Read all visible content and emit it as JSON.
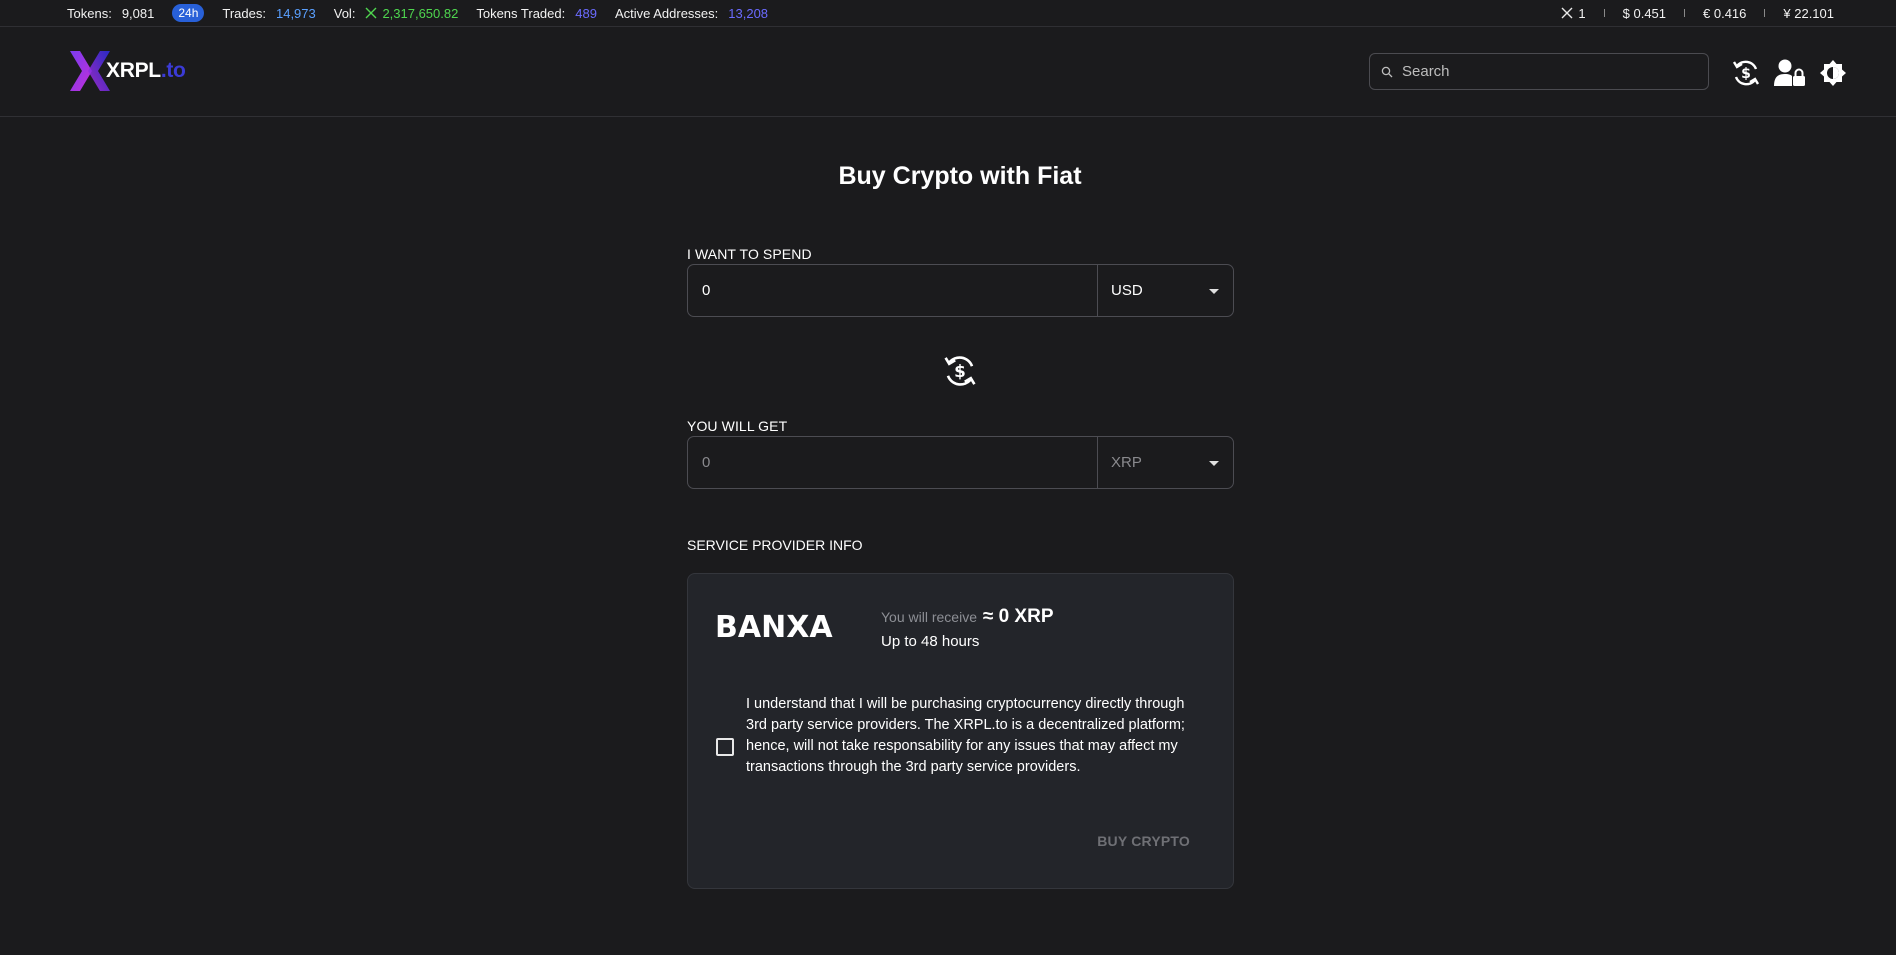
{
  "stats": {
    "tokens_label": "Tokens:",
    "tokens_value": "9,081",
    "period_badge": "24h",
    "trades_label": "Trades:",
    "trades_value": "14,973",
    "vol_label": "Vol:",
    "vol_value": "2,317,650.82",
    "tokens_traded_label": "Tokens Traded:",
    "tokens_traded_value": "489",
    "active_label": "Active Addresses:",
    "active_value": "13,208"
  },
  "prices": {
    "xrp": "1",
    "usd": "$ 0.451",
    "eur": "€ 0.416",
    "cny": "¥ 22.101"
  },
  "header": {
    "logo_main": "XRPL",
    "logo_suffix": ".to",
    "search_placeholder": "Search"
  },
  "page": {
    "title": "Buy Crypto with Fiat"
  },
  "spend": {
    "label": "I WANT TO SPEND",
    "amount": "0",
    "currency": "USD"
  },
  "get": {
    "label": "YOU WILL GET",
    "amount": "0",
    "currency": "XRP"
  },
  "provider": {
    "section_label": "SERVICE PROVIDER INFO",
    "name": "BANXA",
    "receive_prefix": "You will receive",
    "receive_amount": "≈ 0 XRP",
    "eta": "Up to 48 hours",
    "terms": "I understand that I will be purchasing cryptocurrency directly through 3rd party service providers. The XRPL.to is a decentralized platform; hence, will not take responsability for any issues that may affect my transactions through the 3rd party service providers.",
    "buy_label": "BUY CRYPTO"
  },
  "colors": {
    "background": "#1b1b1d",
    "card": "#23252a",
    "accent_blue": "#2860d8",
    "vol_green": "#4fd64f",
    "banxa_teal": "#1ec8c8"
  }
}
